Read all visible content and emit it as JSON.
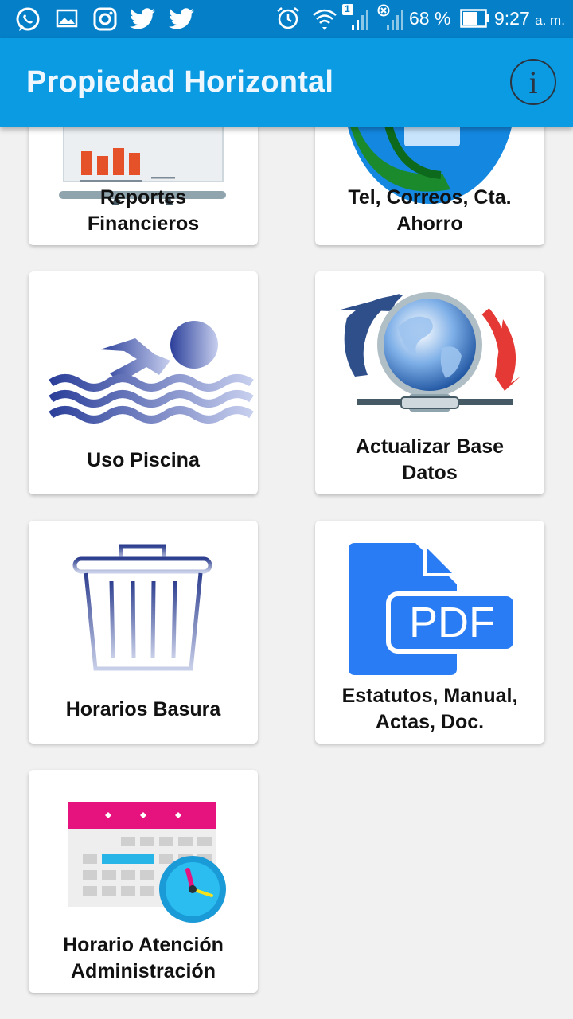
{
  "status_bar": {
    "notification_count": "1",
    "battery": "68 %",
    "time": "9:27",
    "ampm": "a. m."
  },
  "app_bar": {
    "title": "Propiedad Horizontal",
    "info_glyph": "i"
  },
  "menu": [
    {
      "line1": "Reportes",
      "line2": "Financieros",
      "icon": "financial-report-icon"
    },
    {
      "line1": "Tel, Correos, Cta.",
      "line2": "Ahorro",
      "icon": "phone-contact-icon"
    },
    {
      "line1": "Uso Piscina",
      "line2": "",
      "icon": "swimmer-icon"
    },
    {
      "line1": "Actualizar Base",
      "line2": "Datos",
      "icon": "globe-sync-icon"
    },
    {
      "line1": "Horarios Basura",
      "line2": "",
      "icon": "trash-can-icon"
    },
    {
      "line1": "Estatutos, Manual,",
      "line2": "Actas, Doc.",
      "icon": "pdf-document-icon"
    },
    {
      "line1": "Horario Atención",
      "line2": "Administración",
      "icon": "calendar-clock-icon"
    }
  ],
  "pdf_icon_text": "PDF",
  "colors": {
    "status_bar": "#0580c8",
    "app_bar": "#0a9be3",
    "background": "#f1f1f1",
    "pdf_blue": "#2a7cf4",
    "calendar_pink": "#e6127e"
  }
}
